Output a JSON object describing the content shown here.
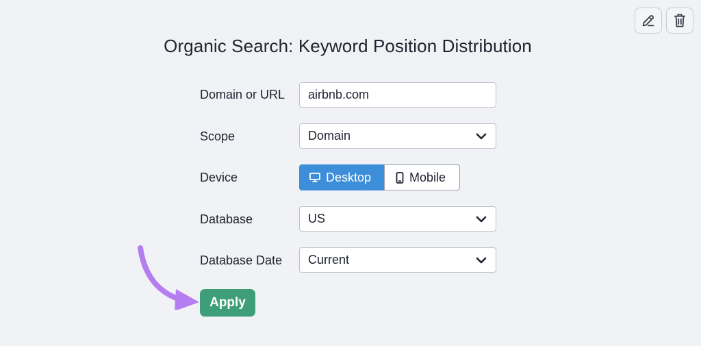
{
  "header": {
    "title": "Organic Search: Keyword Position Distribution",
    "edit_icon": "pencil-icon",
    "delete_icon": "trash-icon"
  },
  "form": {
    "domain": {
      "label": "Domain or URL",
      "value": "airbnb.com"
    },
    "scope": {
      "label": "Scope",
      "value": "Domain"
    },
    "device": {
      "label": "Device",
      "options": [
        {
          "label": "Desktop",
          "icon": "monitor-icon",
          "selected": true
        },
        {
          "label": "Mobile",
          "icon": "phone-icon",
          "selected": false
        }
      ]
    },
    "database": {
      "label": "Database",
      "value": "US"
    },
    "database_date": {
      "label": "Database Date",
      "value": "Current"
    }
  },
  "apply_label": "Apply",
  "colors": {
    "accent_blue": "#3d8ed8",
    "apply_green": "#3d9e79",
    "annotation_arrow": "#b57ef0",
    "background": "#f1f2f5"
  }
}
